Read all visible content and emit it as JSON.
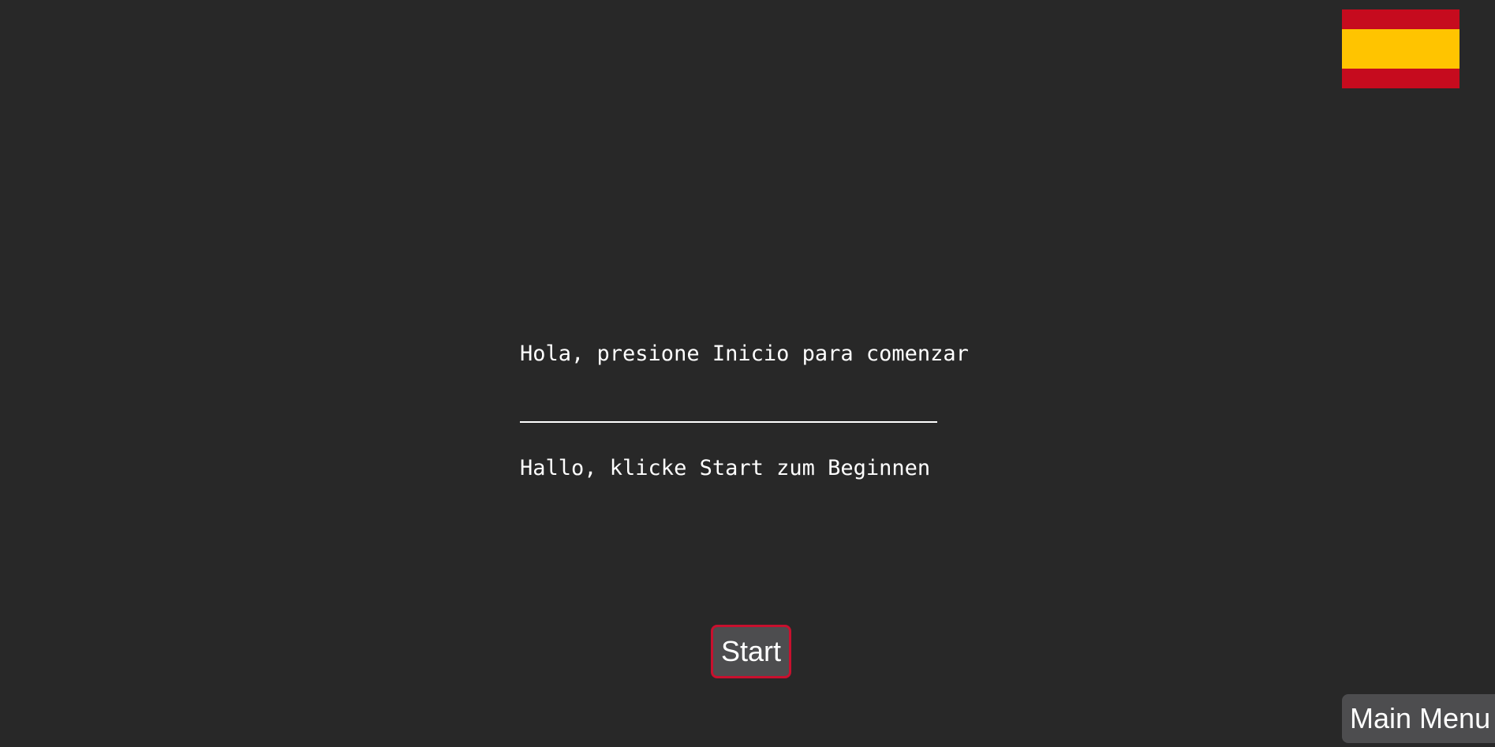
{
  "flag": {
    "icon": "spain-flag-icon",
    "colors": {
      "red": "#c60b1e",
      "yellow": "#ffc400"
    }
  },
  "prompts": {
    "spanish": "Hola, presione Inicio para comenzar",
    "german": "Hallo, klicke Start zum Beginnen"
  },
  "buttons": {
    "start_label": "Start",
    "main_menu_label": "Main Menu"
  },
  "colors": {
    "background": "#282828",
    "button_bg": "#4d4d4f",
    "button_border": "#c8102e",
    "text": "#ffffff"
  }
}
